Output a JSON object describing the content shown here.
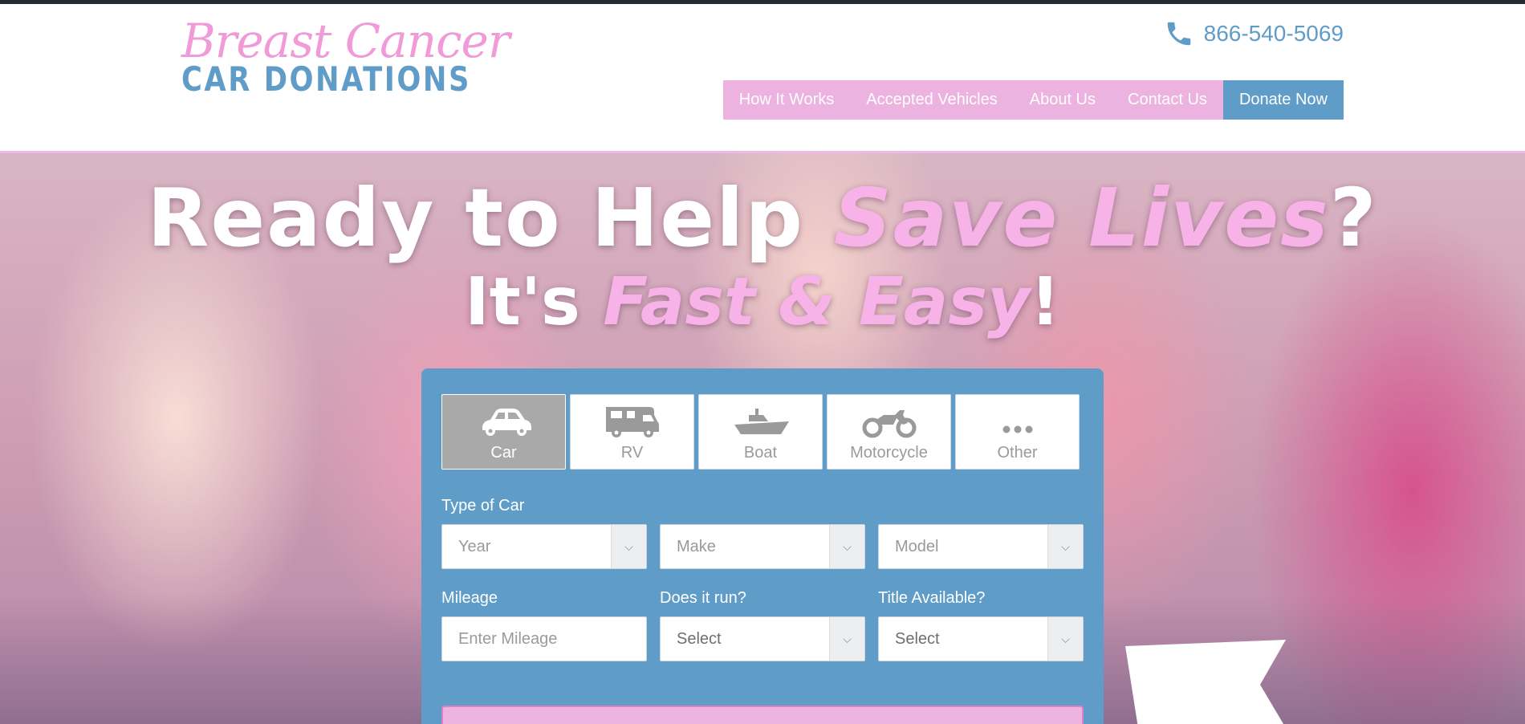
{
  "header": {
    "logo_script": "Breast Cancer",
    "logo_block": "CAR DONATIONS",
    "phone": "866-540-5069",
    "nav": [
      {
        "label": "How It Works"
      },
      {
        "label": "Accepted Vehicles"
      },
      {
        "label": "About Us"
      },
      {
        "label": "Contact Us"
      }
    ],
    "donate_label": "Donate Now"
  },
  "hero": {
    "line1_part1": "Ready to Help ",
    "line1_accent": "Save Lives",
    "line1_end": "?",
    "line2_part1": "It's ",
    "line2_accent": "Fast & Easy",
    "line2_end": "!"
  },
  "form": {
    "vehicle_types": [
      {
        "label": "Car",
        "icon": "car-icon",
        "active": true
      },
      {
        "label": "RV",
        "icon": "rv-icon",
        "active": false
      },
      {
        "label": "Boat",
        "icon": "boat-icon",
        "active": false
      },
      {
        "label": "Motorcycle",
        "icon": "motorcycle-icon",
        "active": false
      },
      {
        "label": "Other",
        "icon": "more-icon",
        "active": false
      }
    ],
    "type_label": "Type of Car",
    "year_placeholder": "Year",
    "make_placeholder": "Make",
    "model_placeholder": "Model",
    "mileage_label": "Mileage",
    "mileage_placeholder": "Enter Mileage",
    "runs_label": "Does it run?",
    "runs_value": "Select",
    "title_label": "Title Available?",
    "title_value": "Select"
  },
  "colors": {
    "pink": "#ecb2e0",
    "blue": "#5f9cc8",
    "accent_pink": "#f7b3e8"
  }
}
